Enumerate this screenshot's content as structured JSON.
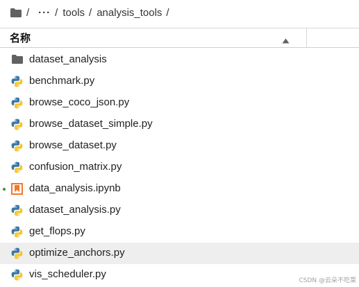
{
  "breadcrumb": {
    "root_separator": "/",
    "ellipsis": "···",
    "items": [
      {
        "label": "tools",
        "sep": "/"
      },
      {
        "label": "analysis_tools",
        "sep": "/"
      }
    ]
  },
  "header": {
    "name_label": "名称",
    "sort_direction": "ascending"
  },
  "files": [
    {
      "name": "dataset_analysis",
      "type": "folder",
      "icon": "folder-icon"
    },
    {
      "name": "benchmark.py",
      "type": "python",
      "icon": "python-icon"
    },
    {
      "name": "browse_coco_json.py",
      "type": "python",
      "icon": "python-icon"
    },
    {
      "name": "browse_dataset_simple.py",
      "type": "python",
      "icon": "python-icon"
    },
    {
      "name": "browse_dataset.py",
      "type": "python",
      "icon": "python-icon"
    },
    {
      "name": "confusion_matrix.py",
      "type": "python",
      "icon": "python-icon"
    },
    {
      "name": "data_analysis.ipynb",
      "type": "notebook",
      "icon": "notebook-icon",
      "running": true
    },
    {
      "name": "dataset_analysis.py",
      "type": "python",
      "icon": "python-icon"
    },
    {
      "name": "get_flops.py",
      "type": "python",
      "icon": "python-icon"
    },
    {
      "name": "optimize_anchors.py",
      "type": "python",
      "icon": "python-icon",
      "selected": true
    },
    {
      "name": "vis_scheduler.py",
      "type": "python",
      "icon": "python-icon"
    }
  ],
  "watermark": "CSDN @云朵不吃菜",
  "colors": {
    "folder": "#616161",
    "python_blue": "#3b77a8",
    "python_yellow": "#f5c731",
    "notebook_orange": "#f37726",
    "selected_row": "#eeeeee",
    "running_dot": "#3a8f3a"
  }
}
